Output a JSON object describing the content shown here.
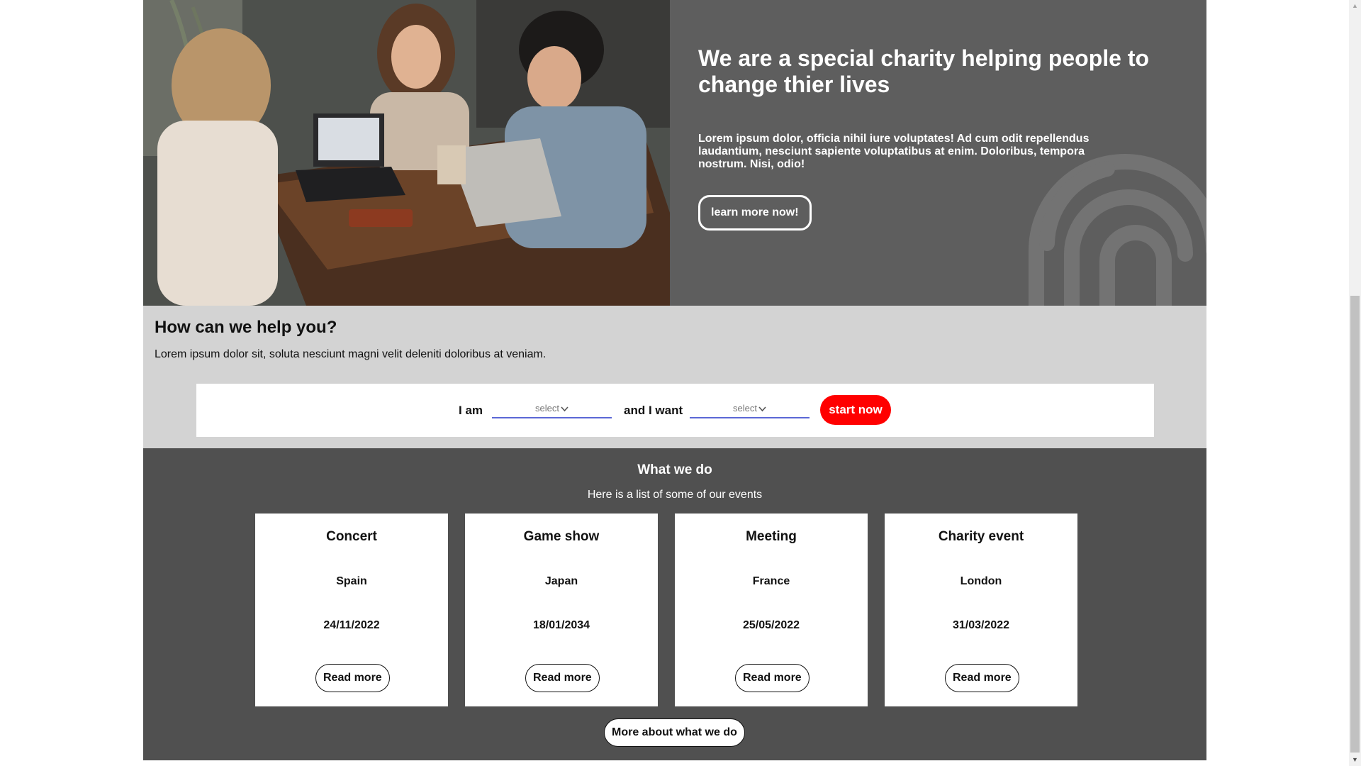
{
  "hero": {
    "photo_alt": "Three women laughing at a table with laptops",
    "title": "We are a special charity helping people to change thier lives",
    "text": "Lorem ipsum dolor, officia nihil iure voluptates! Ad cum odit repellendus laudantium, nesciunt sapiente voluptatibus at enim. Doloribus, tempora nostrum. Nisi, odio!",
    "button_label": "learn more now!",
    "decor_icon": "fingerprint-icon"
  },
  "help": {
    "title": "How can we help you?",
    "text": "Lorem ipsum dolor sit, soluta nesciunt magni velit deleniti doloribus at veniam.",
    "form": {
      "i_am_label": "I am",
      "select_one": "select",
      "and_want_label": "and I want",
      "select_two": "select",
      "start_label": "start now"
    }
  },
  "what_we_do": {
    "title": "What we do",
    "subtitle": "Here is a list of some of our events",
    "events": [
      {
        "title": "Concert",
        "place": "Spain",
        "date": "24/11/2022",
        "button": "Read more"
      },
      {
        "title": "Game show",
        "place": "Japan",
        "date": "18/01/2034",
        "button": "Read more"
      },
      {
        "title": "Meeting",
        "place": "France",
        "date": "25/05/2022",
        "button": "Read more"
      },
      {
        "title": "Charity event",
        "place": "London",
        "date": "31/03/2022",
        "button": "Read more"
      }
    ],
    "more_button": "More about what we do"
  },
  "colors": {
    "hero_panel": "#5e5e5e",
    "help_bg": "#d3d3d3",
    "section_bg": "#505050",
    "accent_red": "#ff0000",
    "select_underline": "#5b67d6"
  }
}
